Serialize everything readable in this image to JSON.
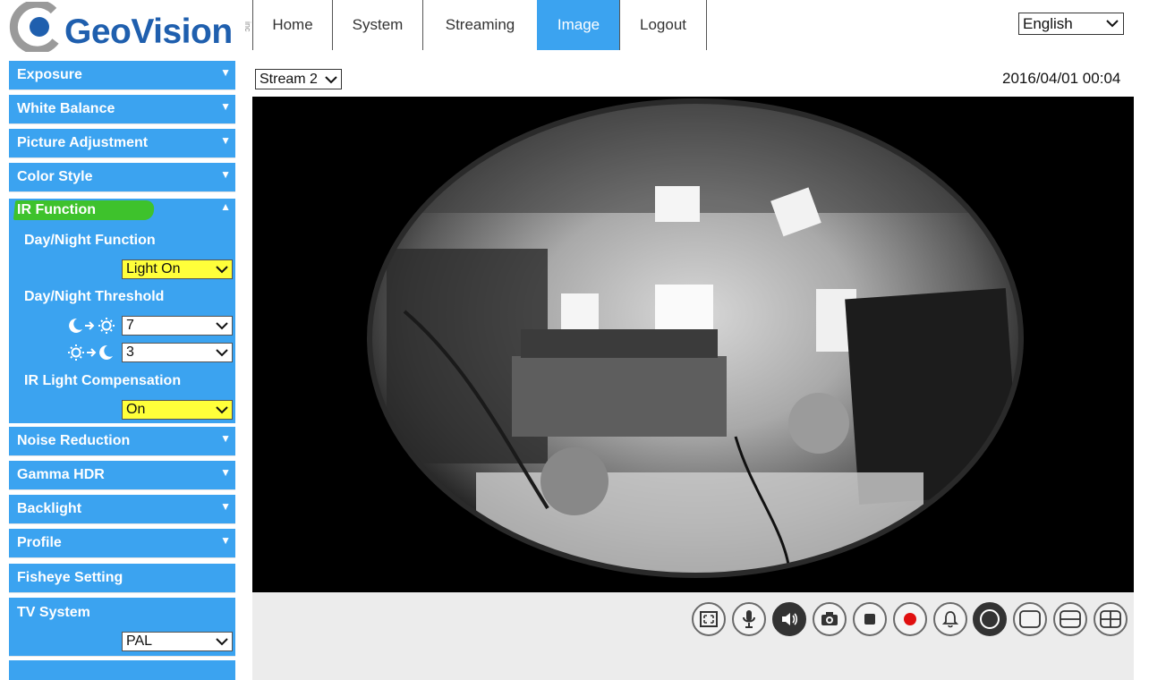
{
  "header": {
    "logo_text": "GeoVision",
    "logo_suffix": "inc",
    "nav": [
      {
        "label": "Home"
      },
      {
        "label": "System"
      },
      {
        "label": "Streaming"
      },
      {
        "label": "Image",
        "active": true
      },
      {
        "label": "Logout"
      }
    ],
    "language": "English"
  },
  "sidebar": {
    "items_top": [
      {
        "label": "Exposure"
      },
      {
        "label": "White Balance"
      },
      {
        "label": "Picture Adjustment"
      },
      {
        "label": "Color Style"
      }
    ],
    "ir_function": {
      "title": "IR Function",
      "day_night_function_label": "Day/Night Function",
      "day_night_function_value": "Light On",
      "threshold_label": "Day/Night Threshold",
      "night_to_day_value": "7",
      "day_to_night_value": "3",
      "ir_compensation_label": "IR Light Compensation",
      "ir_compensation_value": "On"
    },
    "items_bottom": [
      {
        "label": "Noise Reduction"
      },
      {
        "label": "Gamma HDR"
      },
      {
        "label": "Backlight"
      },
      {
        "label": "Profile"
      },
      {
        "label": "Fisheye Setting"
      }
    ],
    "tv_system": {
      "label": "TV System",
      "value": "PAL"
    }
  },
  "main": {
    "stream": "Stream 2",
    "timestamp": "2016/04/01 00:04"
  },
  "toolbar": {
    "buttons": [
      "fullscreen-icon",
      "microphone-icon",
      "speaker-icon",
      "snapshot-icon",
      "stop-icon",
      "record-icon",
      "alarm-icon",
      "fisheye-view-icon",
      "single-view-icon",
      "dual-view-icon",
      "quad-view-icon"
    ]
  },
  "colors": {
    "accent": "#3ba3f0",
    "logo_blue": "#1f5fae",
    "highlight_yellow": "#ffff3a",
    "highlight_green": "#3ec22c",
    "record_red": "#e01010"
  }
}
